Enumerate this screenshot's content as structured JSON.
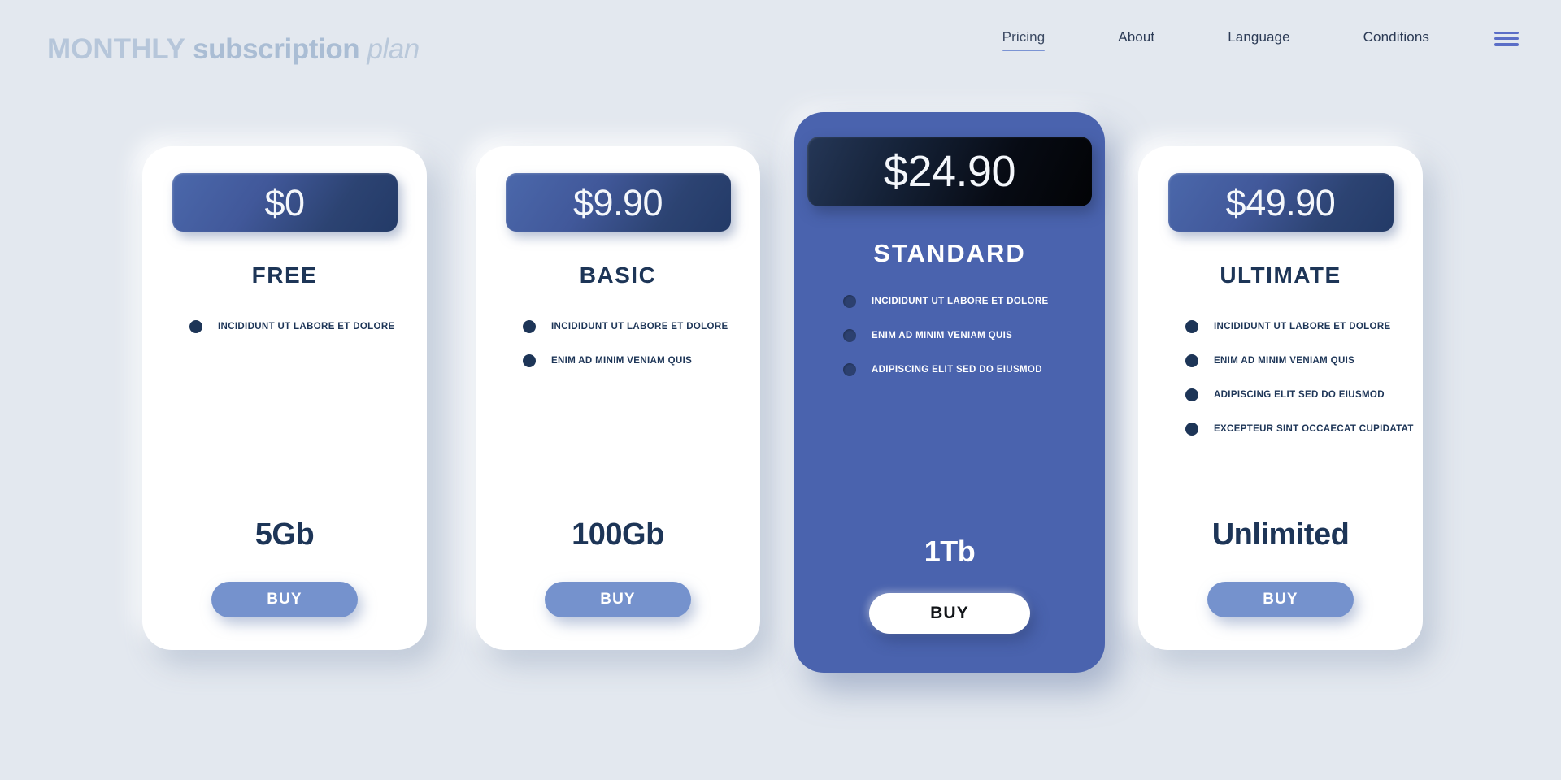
{
  "header": {
    "logo": {
      "word1": "MONTHLY",
      "word2": "subscription",
      "word3": "plan"
    },
    "nav": [
      {
        "label": "Pricing",
        "active": true
      },
      {
        "label": "About",
        "active": false
      },
      {
        "label": "Language",
        "active": false
      },
      {
        "label": "Conditions",
        "active": false
      }
    ],
    "menu_icon": "hamburger-menu-icon"
  },
  "colors": {
    "page_background": "#e3e8ef",
    "card_background": "#ffffff",
    "featured_card_background": "#4a63ae",
    "accent_navy": "#1d3557",
    "accent_periwinkle": "#7592cd",
    "nav_underline": "#7b94d4",
    "hamburger": "#5b6ec7",
    "logo_text": "#b6c6da"
  },
  "plans": [
    {
      "id": "free",
      "price": "$0",
      "title": "FREE",
      "features": [
        "INCIDIDUNT UT LABORE ET DOLORE"
      ],
      "storage": "5Gb",
      "buy_label": "BUY",
      "featured": false
    },
    {
      "id": "basic",
      "price": "$9.90",
      "title": "BASIC",
      "features": [
        "INCIDIDUNT UT LABORE ET DOLORE",
        "ENIM AD MINIM VENIAM QUIS"
      ],
      "storage": "100Gb",
      "buy_label": "BUY",
      "featured": false
    },
    {
      "id": "standard",
      "price": "$24.90",
      "title": "STANDARD",
      "features": [
        "INCIDIDUNT UT LABORE ET DOLORE",
        "ENIM AD MINIM VENIAM QUIS",
        "ADIPISCING ELIT SED DO EIUSMOD"
      ],
      "storage": "1Tb",
      "buy_label": "BUY",
      "featured": true
    },
    {
      "id": "ultimate",
      "price": "$49.90",
      "title": "ULTIMATE",
      "features": [
        "INCIDIDUNT UT LABORE ET DOLORE",
        "ENIM AD MINIM VENIAM QUIS",
        "ADIPISCING ELIT SED DO EIUSMOD",
        "EXCEPTEUR SINT OCCAECAT CUPIDATAT"
      ],
      "storage": "Unlimited",
      "buy_label": "BUY",
      "featured": false
    }
  ]
}
